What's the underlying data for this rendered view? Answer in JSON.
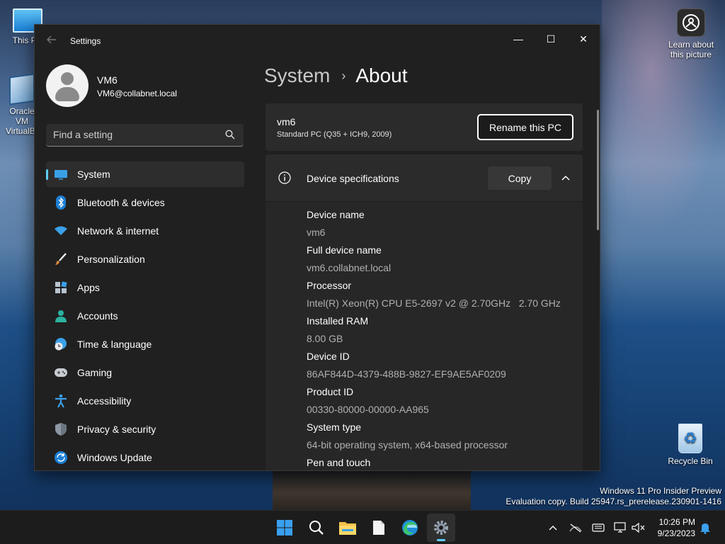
{
  "desktop": {
    "icons": {
      "this_pc": "This PC",
      "vbox": "Oracle VM VirtualBox",
      "learn": "Learn about this picture",
      "recycle": "Recycle Bin"
    },
    "watermark": {
      "line1": "Windows 11 Pro Insider Preview",
      "line2": "Evaluation copy. Build 25947.rs_prerelease.230901-1416"
    }
  },
  "window": {
    "title": "Settings",
    "controls": {
      "minimize": "—",
      "maximize": "☐",
      "close": "✕"
    }
  },
  "profile": {
    "name": "VM6",
    "email": "VM6@collabnet.local"
  },
  "search": {
    "placeholder": "Find a setting"
  },
  "sidebar": {
    "items": [
      {
        "label": "System",
        "icon": "system-icon",
        "active": true
      },
      {
        "label": "Bluetooth & devices",
        "icon": "bluetooth-icon"
      },
      {
        "label": "Network & internet",
        "icon": "wifi-icon"
      },
      {
        "label": "Personalization",
        "icon": "brush-icon"
      },
      {
        "label": "Apps",
        "icon": "apps-icon"
      },
      {
        "label": "Accounts",
        "icon": "accounts-icon"
      },
      {
        "label": "Time & language",
        "icon": "clock-globe-icon"
      },
      {
        "label": "Gaming",
        "icon": "gamepad-icon"
      },
      {
        "label": "Accessibility",
        "icon": "accessibility-icon"
      },
      {
        "label": "Privacy & security",
        "icon": "shield-icon"
      },
      {
        "label": "Windows Update",
        "icon": "update-icon"
      }
    ]
  },
  "breadcrumb": {
    "parent": "System",
    "separator": "›",
    "current": "About"
  },
  "pc_card": {
    "name": "vm6",
    "model": "Standard PC (Q35 + ICH9, 2009)",
    "rename_label": "Rename this PC"
  },
  "device_specs": {
    "title": "Device specifications",
    "copy_label": "Copy",
    "rows": [
      {
        "label": "Device name",
        "value": "vm6"
      },
      {
        "label": "Full device name",
        "value": "vm6.collabnet.local"
      },
      {
        "label": "Processor",
        "value": "Intel(R) Xeon(R) CPU E5-2697 v2 @ 2.70GHz   2.70 GHz"
      },
      {
        "label": "Installed RAM",
        "value": "8.00 GB"
      },
      {
        "label": "Device ID",
        "value": "86AF844D-4379-488B-9827-EF9AE5AF0209"
      },
      {
        "label": "Product ID",
        "value": "00330-80000-00000-AA965"
      },
      {
        "label": "System type",
        "value": "64-bit operating system, x64-based processor"
      },
      {
        "label": "Pen and touch",
        "value": ""
      }
    ]
  },
  "taskbar": {
    "apps": [
      "start-icon",
      "search-icon",
      "file-explorer-icon",
      "notepad-icon",
      "edge-icon",
      "settings-icon"
    ],
    "tray": [
      "chevron-up-icon",
      "network-icon",
      "keyboard-icon",
      "display-icon",
      "volume-icon",
      "notification-icon"
    ],
    "time": "10:26 PM",
    "date": "9/23/2023"
  },
  "colors": {
    "accent": "#60cdff",
    "window_bg": "#202020",
    "card_bg": "#2b2b2b"
  }
}
